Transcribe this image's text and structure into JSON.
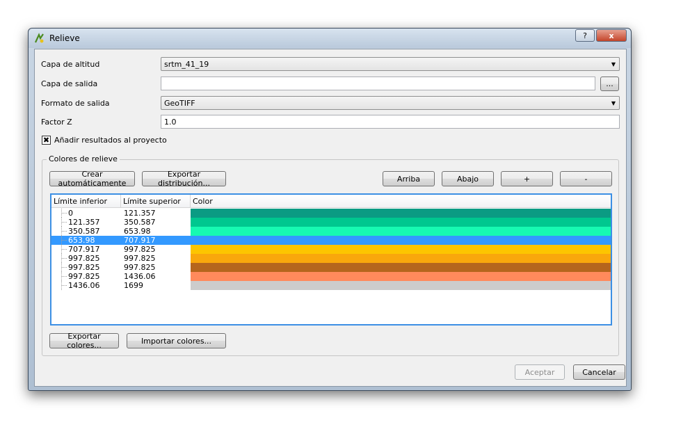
{
  "window": {
    "title": "Relieve"
  },
  "titlebar": {
    "help_label": "?",
    "close_label": "x"
  },
  "form": {
    "elevation_label": "Capa de altitud",
    "elevation_value": "srtm_41_19",
    "output_label": "Capa de salida",
    "output_value": "",
    "browse_label": "...",
    "format_label": "Formato de salida",
    "format_value": "GeoTIFF",
    "zfactor_label": "Factor Z",
    "zfactor_value": "1.0",
    "add_results_label": "Añadir resultados al proyecto",
    "add_results_checked": true
  },
  "colors_group": {
    "title": "Colores de relieve",
    "create_auto_label": "Crear automáticamente",
    "export_dist_label": "Exportar distribución...",
    "up_label": "Arriba",
    "down_label": "Abajo",
    "add_label": "+",
    "remove_label": "-",
    "columns": [
      "Límite inferior",
      "Límite superior",
      "Color"
    ],
    "rows": [
      {
        "lower": "0",
        "upper": "121.357",
        "color": "#0b9b83"
      },
      {
        "lower": "121.357",
        "upper": "350.587",
        "color": "#00c78f"
      },
      {
        "lower": "350.587",
        "upper": "653.98",
        "color": "#17f9b2"
      },
      {
        "lower": "653.98",
        "upper": "707.917",
        "color": "#3399ff"
      },
      {
        "lower": "707.917",
        "upper": "997.825",
        "color": "#fdc500"
      },
      {
        "lower": "997.825",
        "upper": "997.825",
        "color": "#f9a70c"
      },
      {
        "lower": "997.825",
        "upper": "997.825",
        "color": "#b5651d"
      },
      {
        "lower": "997.825",
        "upper": "1436.06",
        "color": "#ff8a5c"
      },
      {
        "lower": "1436.06",
        "upper": "1699",
        "color": "#cccccc"
      }
    ],
    "selected_row": 3,
    "export_colors_label": "Exportar colores...",
    "import_colors_label": "Importar colores..."
  },
  "footer": {
    "accept_label": "Aceptar",
    "cancel_label": "Cancelar"
  }
}
